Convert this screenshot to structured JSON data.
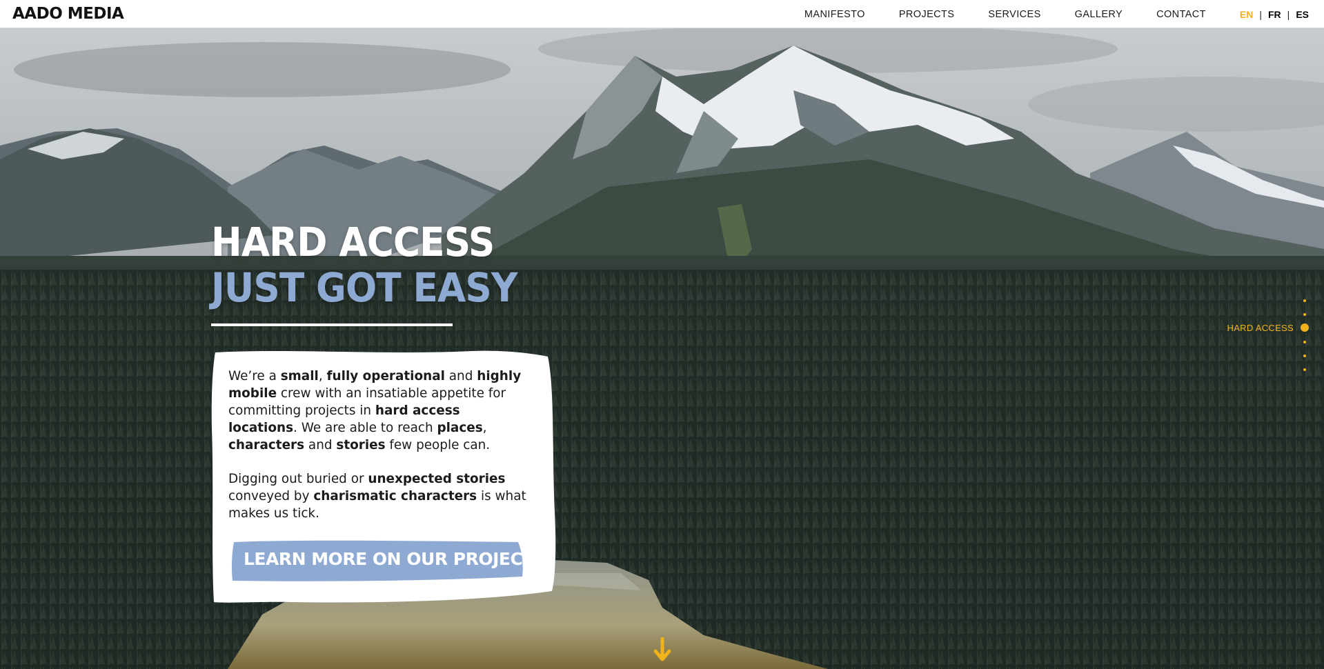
{
  "header": {
    "logo": "AADO MEDIA",
    "nav": [
      "MANIFESTO",
      "PROJECTS",
      "SERVICES",
      "GALLERY",
      "CONTACT"
    ],
    "languages": [
      "EN",
      "FR",
      "ES"
    ],
    "active_language": "EN"
  },
  "hero": {
    "title_line1": "HARD ACCESS",
    "title_line2": "JUST GOT EASY",
    "cta_label": "LEARN MORE ON OUR PROJECTS"
  },
  "side_nav": {
    "active_label": "HARD ACCESS"
  },
  "colors": {
    "accent": "#f2b21b",
    "title_blue": "#8eaad3",
    "cta_blue": "#8eaad3"
  },
  "icons": [
    "down-arrow-icon"
  ]
}
